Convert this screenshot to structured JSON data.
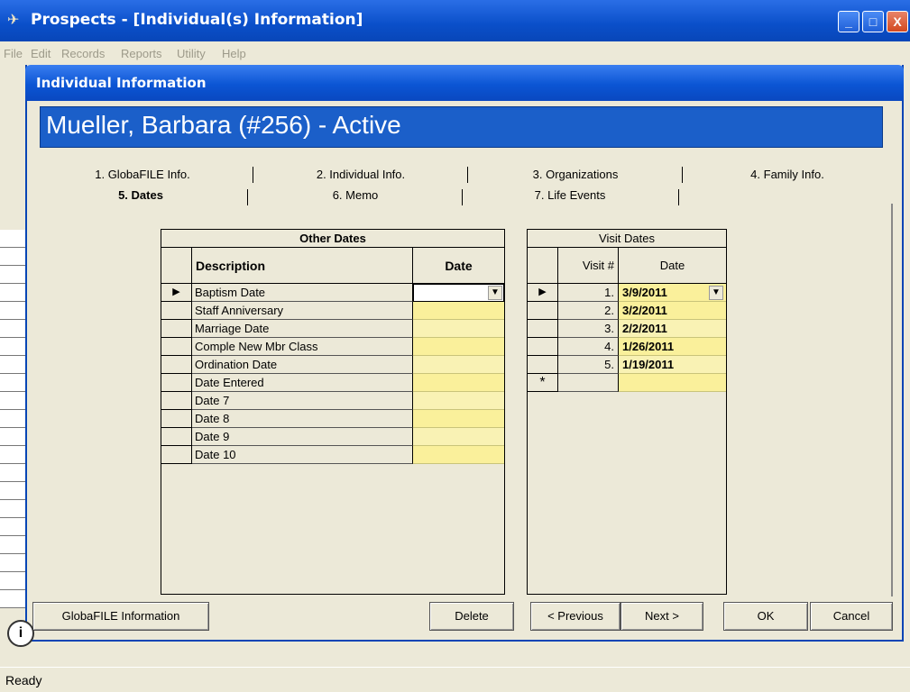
{
  "window": {
    "title": "Prospects - [Individual(s) Information]",
    "min": "_",
    "max": "□",
    "close": "X"
  },
  "menu": [
    "File",
    "Edit",
    "Records",
    "Reports",
    "Utility",
    "Help"
  ],
  "status": "Ready",
  "dialog": {
    "title": "Individual Information",
    "header": "Mueller, Barbara (#256) - Active"
  },
  "tabs_row1": [
    "1. GlobaFILE Info.",
    "2. Individual Info.",
    "3. Organizations",
    "4. Family Info."
  ],
  "tabs_row2": [
    "5. Dates",
    "6. Memo",
    "7. Life Events"
  ],
  "other_dates": {
    "title": "Other Dates",
    "col_desc": "Description",
    "col_date": "Date",
    "rows": [
      "Baptism Date",
      "Staff Anniversary",
      "Marriage Date",
      "Comple New Mbr Class",
      "Ordination Date",
      "Date Entered",
      "Date 7",
      "Date 8",
      "Date 9",
      "Date 10"
    ]
  },
  "visit_dates": {
    "title": "Visit Dates",
    "col_num": "Visit #",
    "col_date": "Date",
    "rows": [
      {
        "num": "1.",
        "date": "3/9/2011"
      },
      {
        "num": "2.",
        "date": "3/2/2011"
      },
      {
        "num": "3.",
        "date": "2/2/2011"
      },
      {
        "num": "4.",
        "date": "1/26/2011"
      },
      {
        "num": "5.",
        "date": "1/19/2011"
      }
    ],
    "new_row_marker": "*"
  },
  "buttons": {
    "globafile": "GlobaFILE Information",
    "delete": "Delete",
    "previous": "< Previous",
    "next": "Next >",
    "ok": "OK",
    "cancel": "Cancel"
  },
  "colors": {
    "titlebar": "#0a4fc9",
    "banner": "#1b5fc9",
    "date_cell": "#faf09b"
  }
}
